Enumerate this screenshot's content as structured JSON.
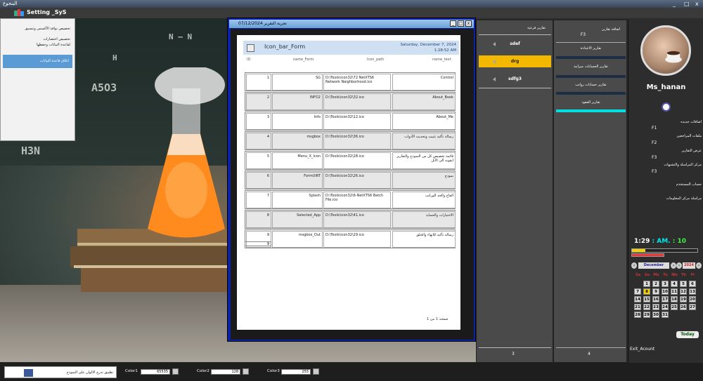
{
  "window": {
    "title": "البنجوع",
    "controls": [
      "_",
      "□",
      "x"
    ]
  },
  "menubar": {
    "title": "Setting _SyS"
  },
  "settings_menu": {
    "items": [
      "تخصيص نوافذ الأكسس وتنسيق",
      "تخصيص اختصارات",
      "لقاعدة البيانات وحفظها"
    ],
    "selected": "اغلاق قاعدة البيانات"
  },
  "report_window": {
    "title": "تجربة التقرير 07/12/2024",
    "report_title": "Icon_bar_Form",
    "date_line": "Saturday, December 7, 2024",
    "time_line": "1:28:52 AM",
    "columns": [
      "ID",
      "name_Form",
      "Icon_path",
      "name_text"
    ],
    "rows": [
      {
        "id": "1",
        "name": "SG",
        "path": "D:\\Tools\\icon32\\72 NetXTS6 Network Neighborhood.ico",
        "text": "Control"
      },
      {
        "id": "2",
        "name": "INFO2",
        "path": "D:\\Tools\\icon32\\32.ico",
        "text": "About_Book"
      },
      {
        "id": "3",
        "name": "Info",
        "path": "D:\\Tools\\icon32\\12.ico",
        "text": "About_Me"
      },
      {
        "id": "4",
        "name": "msgbox",
        "path": "D:\\Tools\\icon32\\36.ico",
        "text": "رسالة تأكيد تثبيت وتحديث الأدوات"
      },
      {
        "id": "5",
        "name": "Menu_X_Icon",
        "path": "D:\\Tools\\icon32\\28.ico",
        "text": "قائمة تخصيص كل من النموذج والتقارير ايقونه الى الأيل"
      },
      {
        "id": "6",
        "name": "FormUIRT",
        "path": "D:\\Tools\\icon32\\26.ico",
        "text": "نموذج"
      },
      {
        "id": "7",
        "name": "Splash",
        "path": "D:\\Tools\\icon32\\6-NetXTS6 Batch File.ico",
        "text": "الفاخ والحد الوراتب"
      },
      {
        "id": "8",
        "name": "Selected_App",
        "path": "D:\\Tools\\icon32\\41.ico",
        "text": "الاختيارات والحماية"
      },
      {
        "id": "9",
        "name": "msgbox_Out",
        "path": "D:\\Tools\\icon32\\29.ico",
        "text": "رسالة تأكيد للانهاء والخلق"
      }
    ],
    "count_box": "9",
    "page_footer": "صفحة 1 من 1"
  },
  "nav_panel": {
    "header": "تقارير فرعية",
    "items": [
      "sdef",
      "drg",
      "sdfg3"
    ],
    "active": "drg",
    "footer": "3"
  },
  "reports_panel": {
    "items": [
      {
        "label": "اضافة تقارير",
        "sub": "F3"
      },
      {
        "label": "تقارير الاعدادة"
      },
      {
        "label": "تقارير الحسابات ميزانية"
      },
      {
        "label": "تقارير حسابات رواتب"
      },
      {
        "label": "تقارير العقود"
      }
    ],
    "footer": "4"
  },
  "user_panel": {
    "username": "Ms_hanan",
    "menu": [
      {
        "label": "اضافات جديده",
        "key": "F1"
      },
      {
        "label": "ملفات المراجعين",
        "key": "F2"
      },
      {
        "label": "عرض التقارير",
        "key": "F3"
      },
      {
        "label": "مركز المراسلة والتشبهات",
        "key": "F3"
      }
    ],
    "account_label": "حساب المستخدم",
    "info_label": "مراسلة مركز المعلومات",
    "time": {
      "hm": "1:29",
      "ampm": ": AM.",
      "sep": ":",
      "sec": "10"
    },
    "progress": 0.2,
    "calendar": {
      "month": "December",
      "year": "2024",
      "dow": [
        "Sa",
        "Su",
        "Mo",
        "Tu",
        "We",
        "Th",
        "Fr"
      ],
      "days": [
        "1",
        "2",
        "3",
        "4",
        "5",
        "6",
        "7",
        "8",
        "9",
        "10",
        "11",
        "12",
        "13",
        "14",
        "15",
        "16",
        "17",
        "18",
        "19",
        "20",
        "21",
        "22",
        "23",
        "24",
        "25",
        "26",
        "27",
        "28",
        "29",
        "30",
        "31"
      ],
      "today": "8",
      "today_button": "Today"
    },
    "exit": "Exit_Acount"
  },
  "statusbar": {
    "app_button": "تطبيق تدرج الالوان على النموذج",
    "colors": [
      {
        "label": "Color1",
        "value": "65535"
      },
      {
        "label": "Color2",
        "value": "128"
      },
      {
        "label": "Color3",
        "value": "255"
      }
    ]
  },
  "accent_colors": {
    "gold": "#f5b800",
    "cyan": "#00e0e0",
    "report_border": "#0c22a6"
  }
}
